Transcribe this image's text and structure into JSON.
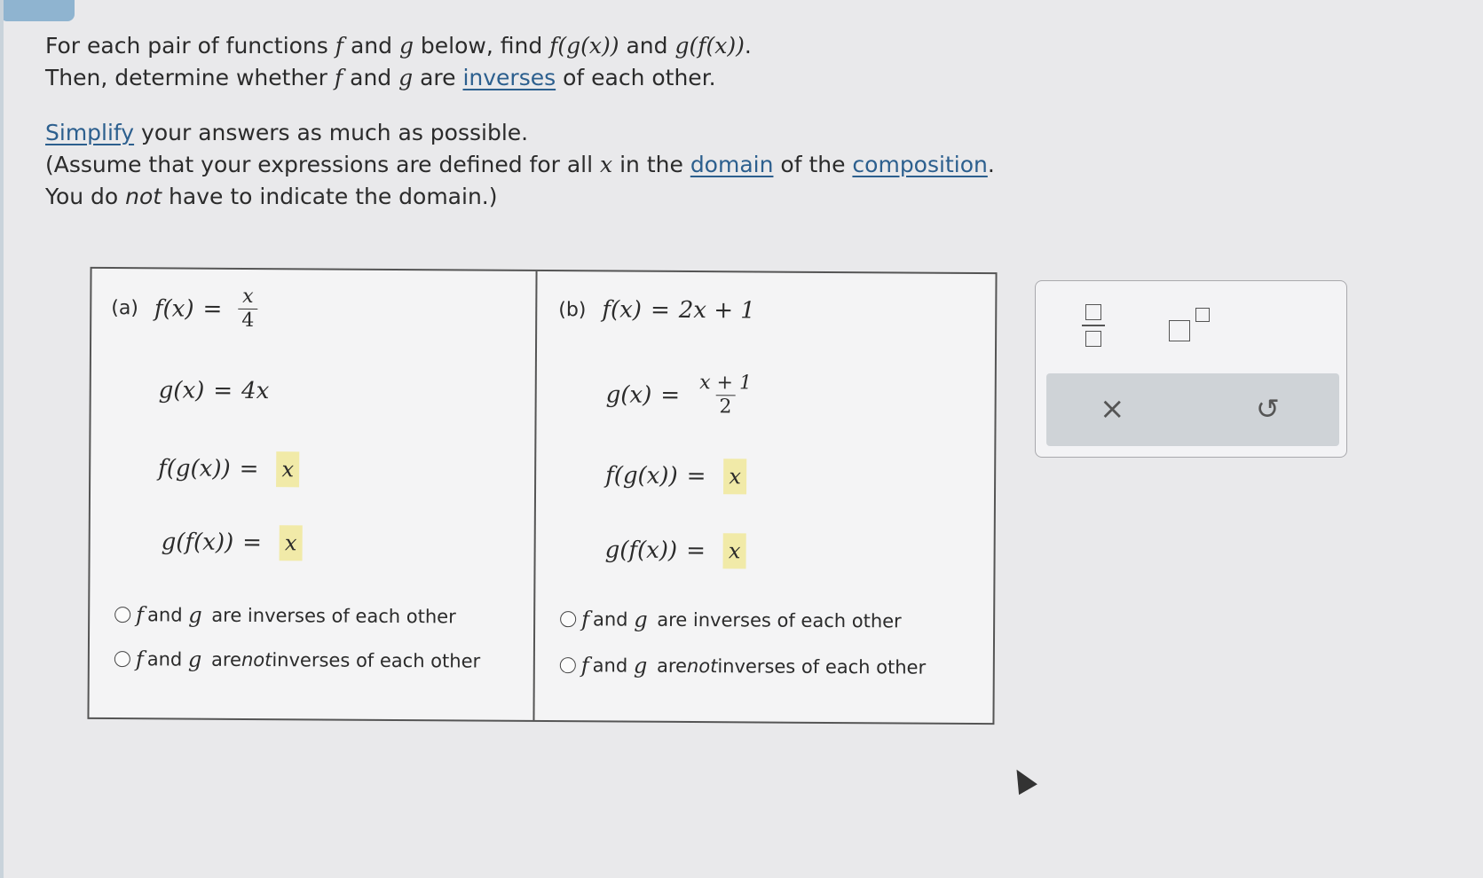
{
  "instructions": {
    "line1_a": "For each pair of functions ",
    "f": "f",
    "and": " and ",
    "g": "g",
    "line1_b": " below, find ",
    "fgx": "f(g(x))",
    "gfx": "g(f(x))",
    "period": ".",
    "line2_a": "Then, determine whether ",
    "line2_b": " are ",
    "inverses_link": "inverses",
    "line2_c": " of each other.",
    "simplify_link": "Simplify",
    "line3": " your answers as much as possible.",
    "line4_a": "(Assume that your expressions are defined for all ",
    "x": "x",
    "line4_b": " in the ",
    "domain_link": "domain",
    "line4_c": " of the ",
    "composition_link": "composition",
    "line4_d": ".",
    "line5_a": "You do ",
    "not": "not",
    "line5_b": " have to indicate the domain.)"
  },
  "part_a": {
    "label": "(a)",
    "f_lhs": "f(x)",
    "f_num": "x",
    "f_den": "4",
    "g_lhs": "g(x)",
    "g_rhs": "4x",
    "fg_lhs": "f(g(x))",
    "fg_answer": "x",
    "gf_lhs": "g(f(x))",
    "gf_answer": "x",
    "opt1": "are inverses of each other",
    "opt2_pre": "are ",
    "opt2_not": "not",
    "opt2_post": " inverses of each other"
  },
  "part_b": {
    "label": "(b)",
    "f_lhs": "f(x)",
    "f_rhs": "2x + 1",
    "g_lhs": "g(x)",
    "g_num": "x + 1",
    "g_den": "2",
    "fg_lhs": "f(g(x))",
    "fg_answer": "x",
    "gf_lhs": "g(f(x))",
    "gf_answer": "x",
    "opt1": "are inverses of each other",
    "opt2_pre": "are ",
    "opt2_not": "not",
    "opt2_post": " inverses of each other"
  },
  "common": {
    "f": "f",
    "g": "g",
    "and": " and ",
    "eq": "="
  },
  "palette": {
    "clear_icon": "×",
    "undo_icon": "↺"
  }
}
